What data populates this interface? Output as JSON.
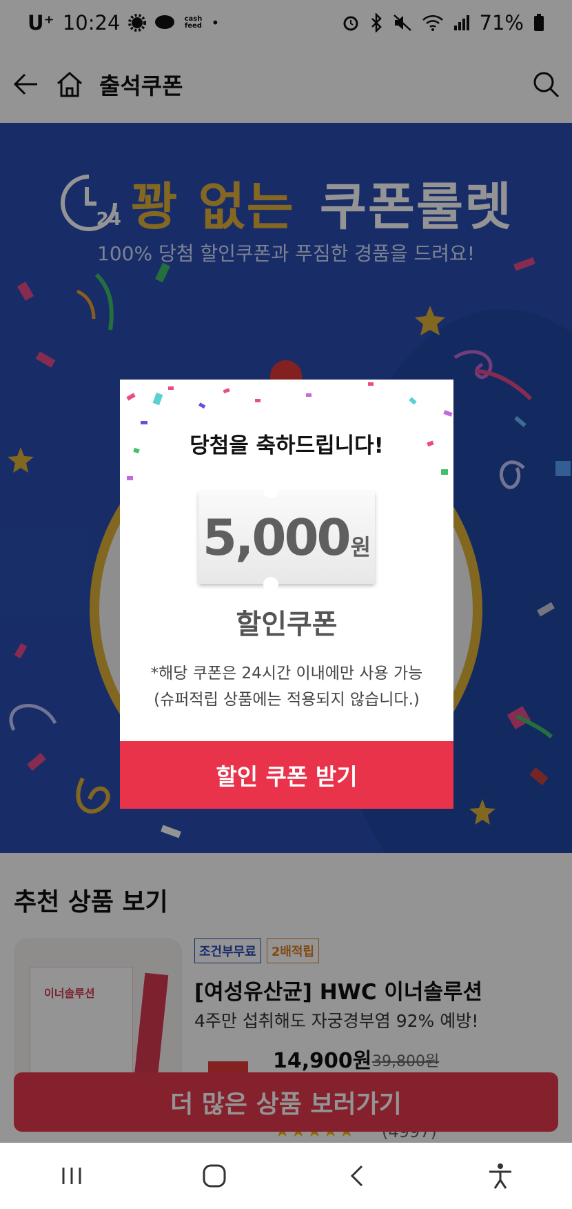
{
  "status_bar": {
    "carrier": "U⁺",
    "time": "10:24",
    "cashfeed": "cash feed",
    "battery": "71%"
  },
  "header": {
    "title": "출석쿠폰"
  },
  "hero": {
    "title_part1": "꽝 없는",
    "title_part2": "쿠폰룰렛",
    "badge": "24",
    "subtitle": "100% 당첨 할인쿠폰과 푸짐한 경품을 드려요!"
  },
  "modal": {
    "title": "당첨을 축하드립니다!",
    "amount": "5,000",
    "unit": "원",
    "label": "할인쿠폰",
    "note1": "*해당 쿠폰은 24시간 이내에만 사용 가능",
    "note2": "(슈퍼적립 상품에는 적용되지 않습니다.)",
    "button": "할인 쿠폰 받기"
  },
  "recommend": {
    "title": "추천 상품 보기",
    "product": {
      "badge1": "조건부무료",
      "badge2": "2배적립",
      "name": "[여성유산균] HWC 이너솔루션",
      "desc": "4주만 섭취해도 자궁경부염 92% 예방!",
      "price": "14,900원",
      "old_price": "39,800원",
      "box_text": "이너솔루션",
      "rating_count": "(4997)"
    },
    "more_button": "더 많은 상품 보러가기"
  },
  "colors": {
    "hero_bg": "#2a4fb3",
    "gold": "#e2b23c",
    "cta": "#e8334a"
  }
}
